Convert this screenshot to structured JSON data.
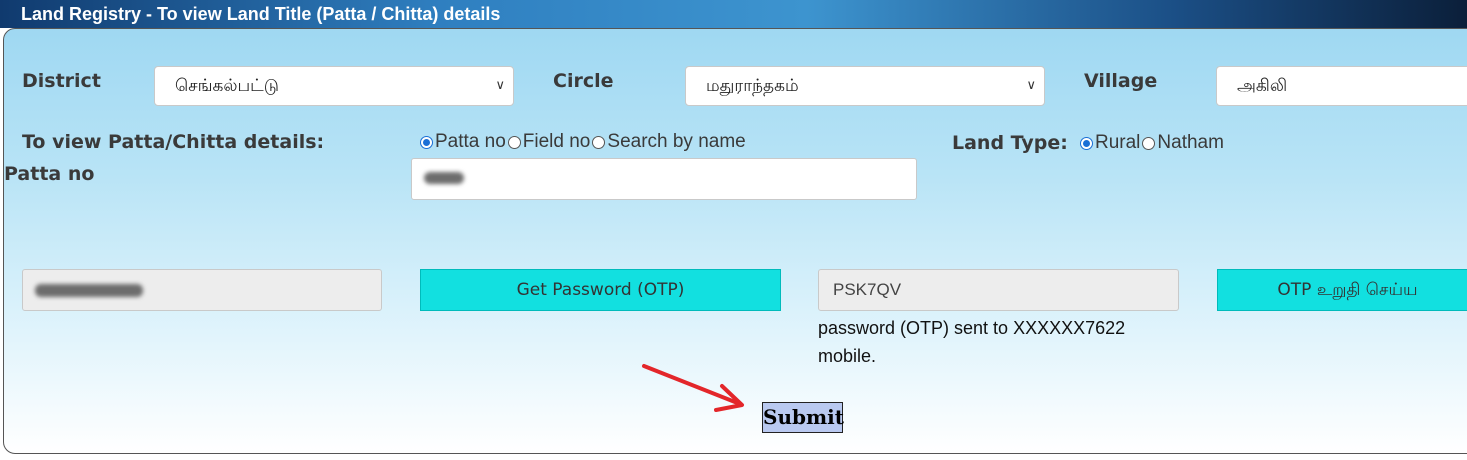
{
  "header": {
    "title": "Land Registry - To view Land Title (Patta / Chitta) details"
  },
  "location": {
    "district_label": "District",
    "district_value": "செங்கல்பட்டு",
    "circle_label": "Circle",
    "circle_value": "மதுராந்தகம்",
    "village_label": "Village",
    "village_value": "அகிலி"
  },
  "view_options": {
    "label": "To view Patta/Chitta details:",
    "options": [
      "Patta no",
      "Field no",
      "Search by name"
    ],
    "selected": "Patta no"
  },
  "land_type": {
    "label": "Land Type:",
    "options": [
      "Rural",
      "Natham"
    ],
    "selected": "Rural"
  },
  "patta": {
    "label": "Patta no"
  },
  "otp": {
    "get_button_label": "Get Password (OTP)",
    "captcha_value": "PSK7QV",
    "confirm_button_label": "OTP உறுதி செய்ய",
    "message": "password (OTP) sent to XXXXXX7622 mobile."
  },
  "form": {
    "submit_label": "Submit"
  },
  "colors": {
    "header_bg": "#1b4f86",
    "panel_bg": "#b9e4f6",
    "button_cyan": "#12e0e0",
    "radio_accent": "#1a6fd6",
    "submit_bg": "#b9c9f0",
    "arrow_red": "#e3262a"
  }
}
